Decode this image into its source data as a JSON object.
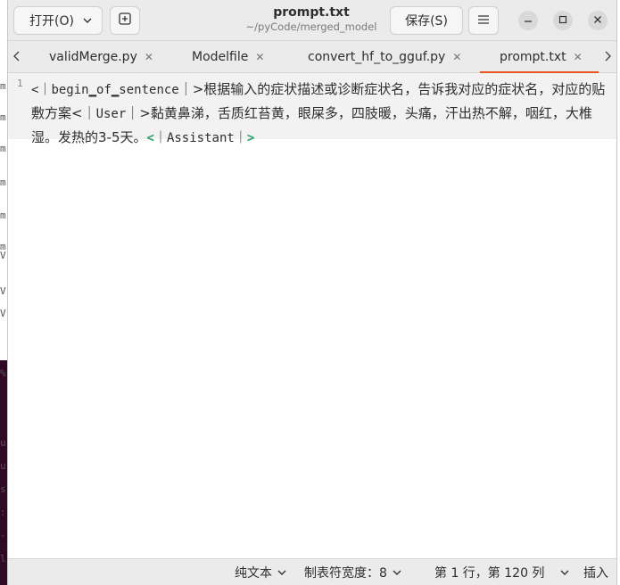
{
  "header": {
    "open_label": "打开(O)",
    "title": "prompt.txt",
    "subtitle": "~/pyCode/merged_model",
    "save_label": "保存(S)"
  },
  "tabs": [
    {
      "label": "validMerge.py"
    },
    {
      "label": "Modelfile"
    },
    {
      "label": "convert_hf_to_gguf.py"
    },
    {
      "label": "prompt.txt",
      "active": true
    }
  ],
  "editor": {
    "line_number": "1",
    "t1": "<｜",
    "t2": "begin▁of▁sentence",
    "t3": "｜>根据输入的症状描述或诊断症状名，告诉我对应的症状名，对应的贴敷方案<｜",
    "t4": "User",
    "t5": "｜>黏黄鼻涕，舌质红苔黄，眼屎多，四肢暖，头痛，汗出热不解，咽红，大椎湿。发热的3-5天。",
    "t6": "<",
    "t7": "｜",
    "t8": "Assistant",
    "t9": "｜",
    "t10": ">"
  },
  "status": {
    "format": "纯文本",
    "tab_width": "制表符宽度：8",
    "position": "第 1 行，第 120 列",
    "mode": "插入"
  },
  "colors": {
    "accent": "#e95420",
    "bracket_highlight": "#26a269"
  },
  "background": {
    "left_chars_top": [
      "m",
      "m",
      "m",
      "m",
      "m",
      "m",
      "V",
      "V",
      "V"
    ],
    "left_chars_bottom": [
      "%",
      "u",
      "u",
      "s",
      ":",
      "-",
      "l"
    ]
  }
}
